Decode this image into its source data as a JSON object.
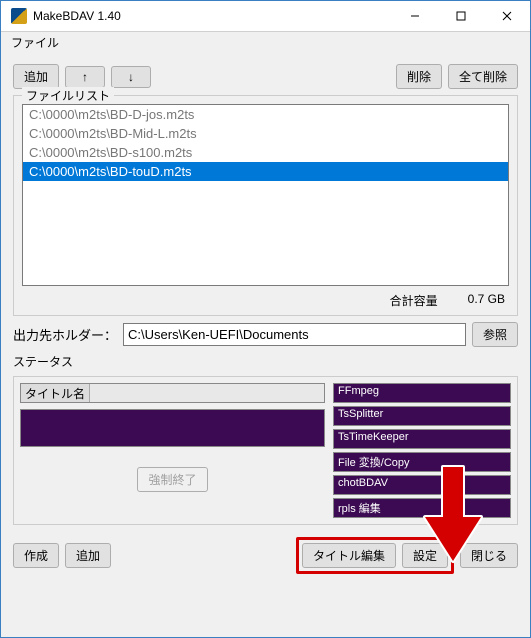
{
  "window": {
    "title": "MakeBDAV 1.40"
  },
  "menu": {
    "file": "ファイル"
  },
  "toolbar": {
    "add": "追加",
    "up": "↑",
    "down": "↓",
    "delete": "削除",
    "delete_all": "全て削除"
  },
  "filelist": {
    "title": "ファイルリスト",
    "items": [
      {
        "path": "C:\\0000\\m2ts\\BD-D-jos.m2ts",
        "selected": false
      },
      {
        "path": "C:\\0000\\m2ts\\BD-Mid-L.m2ts",
        "selected": false
      },
      {
        "path": "C:\\0000\\m2ts\\BD-s100.m2ts",
        "selected": false
      },
      {
        "path": "C:\\0000\\m2ts\\BD-touD.m2ts",
        "selected": true
      }
    ],
    "total_label": "合計容量",
    "total_value": "0.7 GB"
  },
  "output": {
    "label": "出力先ホルダー：",
    "path": "C:\\Users\\Ken-UEFI\\Documents",
    "browse": "参照"
  },
  "status": {
    "title": "ステータス",
    "title_name_label": "タイトル名",
    "abort": "強制終了",
    "stages": [
      "FFmpeg",
      "TsSplitter",
      "TsTimeKeeper",
      "File 変換/Copy",
      "chotBDAV",
      "rpls 編集"
    ]
  },
  "bottom": {
    "create": "作成",
    "add": "追加",
    "title_edit": "タイトル編集",
    "settings": "設定",
    "close": "閉じる"
  }
}
